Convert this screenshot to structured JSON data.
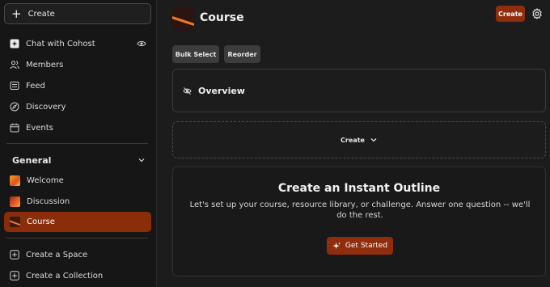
{
  "sidebar": {
    "create_label": "Create",
    "nav": [
      {
        "label": "Chat with Cohost",
        "icon": "sparkle-chat-icon"
      },
      {
        "label": "Members",
        "icon": "members-icon"
      },
      {
        "label": "Feed",
        "icon": "feed-icon"
      },
      {
        "label": "Discovery",
        "icon": "compass-icon"
      },
      {
        "label": "Events",
        "icon": "calendar-icon"
      }
    ],
    "section_title": "General",
    "spaces": [
      {
        "label": "Welcome",
        "icon": "welcome-thumbnail"
      },
      {
        "label": "Discussion",
        "icon": "discussion-thumbnail"
      },
      {
        "label": "Course",
        "icon": "course-thumbnail",
        "active": true
      }
    ],
    "actions": [
      {
        "label": "Create a Space",
        "icon": "plus-square-icon"
      },
      {
        "label": "Create a Collection",
        "icon": "plus-square-icon"
      }
    ]
  },
  "header": {
    "title": "Course",
    "create_label": "Create"
  },
  "toolbar": {
    "bulk_select_label": "Bulk Select",
    "reorder_label": "Reorder"
  },
  "overview": {
    "label": "Overview"
  },
  "create_dropdown": {
    "label": "Create"
  },
  "outline": {
    "title": "Create an Instant Outline",
    "description": "Let's set up your course, resource library, or challenge. Answer one question -- we'll do the rest.",
    "button_label": "Get Started"
  },
  "colors": {
    "accent": "#8f2d0c",
    "active_bg": "#8a2d0a",
    "background": "#1c1c1c",
    "sidebar_bg": "#161616"
  }
}
